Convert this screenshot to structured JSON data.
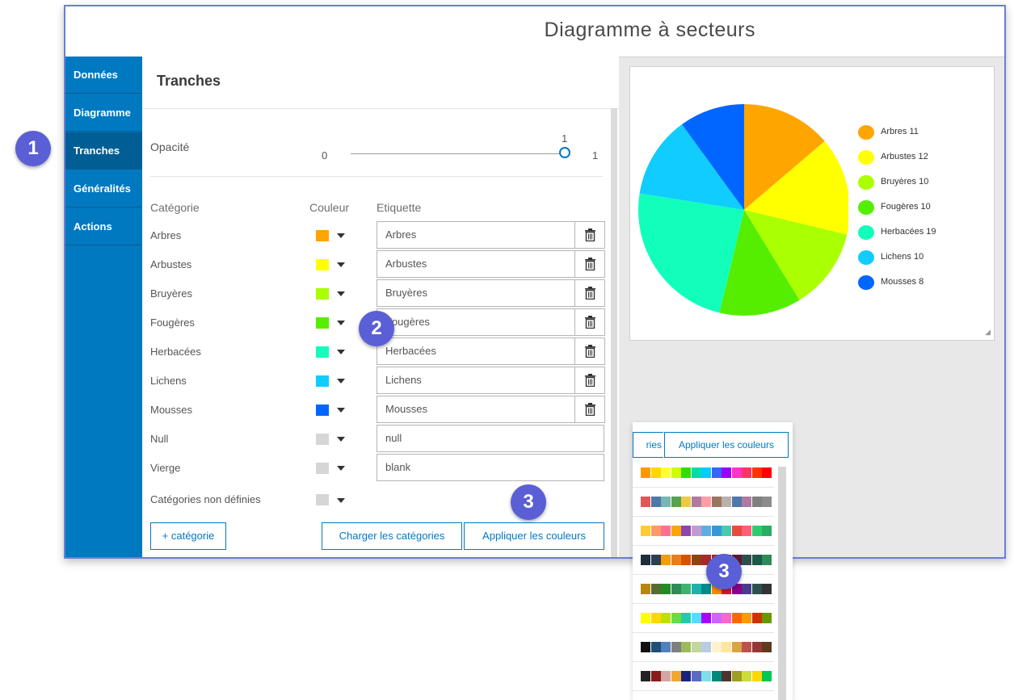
{
  "window": {
    "title": "Diagramme à secteurs"
  },
  "sidebar": {
    "items": [
      {
        "label": "Données"
      },
      {
        "label": "Diagramme"
      },
      {
        "label": "Tranches"
      },
      {
        "label": "Généralités"
      },
      {
        "label": "Actions"
      }
    ],
    "active": "Tranches"
  },
  "panel": {
    "title": "Tranches",
    "opacity": {
      "label": "Opacité",
      "min": "0",
      "max": "1",
      "value": "1",
      "value_fraction": 1.0
    },
    "headers": {
      "category": "Catégorie",
      "color": "Couleur",
      "label": "Etiquette"
    },
    "rows": [
      {
        "category": "Arbres",
        "color": "#ffa500",
        "label": "Arbres",
        "deletable": true
      },
      {
        "category": "Arbustes",
        "color": "#ffff00",
        "label": "Arbustes",
        "deletable": true
      },
      {
        "category": "Bruyères",
        "color": "#aaff00",
        "label": "Bruyères",
        "deletable": true
      },
      {
        "category": "Fougères",
        "color": "#55ee00",
        "label": "Fougères",
        "deletable": true
      },
      {
        "category": "Herbacées",
        "color": "#11ffbb",
        "label": "Herbacées",
        "deletable": true
      },
      {
        "category": "Lichens",
        "color": "#11ccff",
        "label": "Lichens",
        "deletable": true
      },
      {
        "category": "Mousses",
        "color": "#0066ff",
        "label": "Mousses",
        "deletable": true
      },
      {
        "category": "Null",
        "color": "#d6d6d6",
        "label": "null",
        "deletable": false
      },
      {
        "category": "Vierge",
        "color": "#d6d6d6",
        "label": "blank",
        "deletable": false
      }
    ],
    "undefined_categories": {
      "label": "Catégories non définies",
      "color": "#d6d6d6"
    },
    "buttons": {
      "add_category": "+ catégorie",
      "load_categories": "Charger les catégories",
      "apply_colors": "Appliquer les couleurs"
    }
  },
  "chart_data": {
    "type": "pie",
    "categories": [
      "Arbres",
      "Arbustes",
      "Bruyères",
      "Fougères",
      "Herbacées",
      "Lichens",
      "Mousses"
    ],
    "values": [
      11,
      12,
      10,
      10,
      19,
      10,
      8
    ],
    "colors": [
      "#ffa500",
      "#ffff00",
      "#aaff00",
      "#55ee00",
      "#11ffbb",
      "#11ccff",
      "#0066ff"
    ],
    "legend_labels": [
      "Arbres 11",
      "Arbustes 12",
      "Bruyères 10",
      "Fougères 10",
      "Herbacées 19",
      "Lichens 10",
      "Mousses 8"
    ],
    "legend": "right"
  },
  "palette_popup": {
    "tab_partial": "ries",
    "tab_apply": "Appliquer les couleurs",
    "palettes": [
      [
        "#ff9900",
        "#ffd700",
        "#ffff33",
        "#ccff00",
        "#33dd00",
        "#00ddaa",
        "#00ccff",
        "#3366ff",
        "#9900ff",
        "#ff33cc",
        "#ff3366",
        "#ff3300",
        "#ff0000"
      ],
      [
        "#e15759",
        "#4e79a7",
        "#76b7b2",
        "#59a14f",
        "#edc948",
        "#b07aa1",
        "#ff9da7",
        "#9c755f",
        "#bab0ac",
        "#4e79a7",
        "#af7aa1",
        "#7f7f7f",
        "#8c8c8c"
      ],
      [
        "#ffcc33",
        "#ff9966",
        "#ff6f91",
        "#f9a602",
        "#8e44ad",
        "#c39bd3",
        "#5dade2",
        "#3498db",
        "#48c9b0",
        "#e74c3c",
        "#ff5e78",
        "#2ecc71",
        "#27ae60"
      ],
      [
        "#1f2d3d",
        "#2c3e50",
        "#f39c12",
        "#e67e22",
        "#d35400",
        "#8b4513",
        "#a52a2a",
        "#b22222",
        "#800020",
        "#5d1a2e",
        "#2f4f4f",
        "#1e5945",
        "#2e8b57"
      ],
      [
        "#b8860b",
        "#556b2f",
        "#228b22",
        "#2e8b57",
        "#3cb371",
        "#20b2aa",
        "#008b8b",
        "#ff8c00",
        "#dc143c",
        "#8b008b",
        "#483d8b",
        "#2f4f4f",
        "#333333"
      ],
      [
        "#ffff00",
        "#ffd700",
        "#c0e000",
        "#66dd44",
        "#22ccaa",
        "#55ddff",
        "#aa00ff",
        "#cc66ff",
        "#ff66cc",
        "#ff6600",
        "#ff9900",
        "#cc3300",
        "#669900"
      ],
      [
        "#111111",
        "#1f4e79",
        "#4f81bd",
        "#7f7f7f",
        "#9bbb59",
        "#c3d69b",
        "#b8cce4",
        "#fff2cc",
        "#ffe699",
        "#d9a441",
        "#c0504d",
        "#953735",
        "#5f3b1e"
      ],
      [
        "#222222",
        "#8b1a1a",
        "#d4a5a5",
        "#f0a830",
        "#1a237e",
        "#5c6bc0",
        "#80deea",
        "#00897b",
        "#4e342e",
        "#9e9d24",
        "#cddc39",
        "#ffd600",
        "#00c853"
      ]
    ]
  },
  "badges": [
    "1",
    "2",
    "3",
    "3"
  ]
}
